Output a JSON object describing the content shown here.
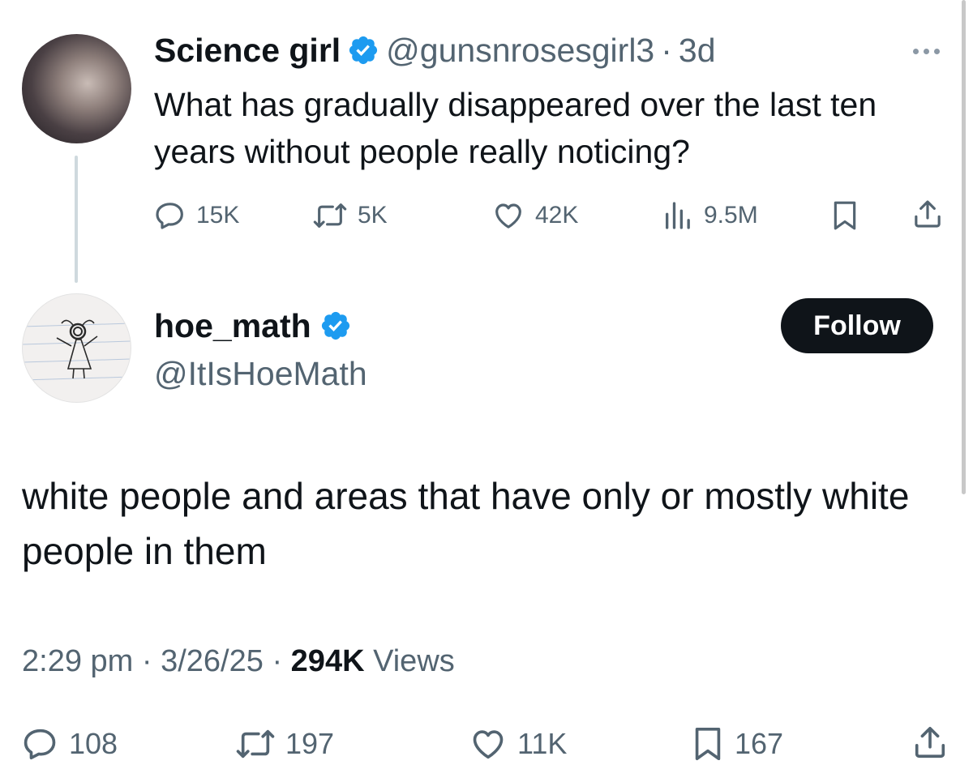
{
  "parent_tweet": {
    "display_name": "Science girl",
    "handle": "@gunsnrosesgirl3",
    "separator": "·",
    "age": "3d",
    "text": "What has gradually disappeared over the last ten years without people really noticing?",
    "stats": {
      "replies": "15K",
      "reposts": "5K",
      "likes": "42K",
      "views": "9.5M"
    }
  },
  "reply_tweet": {
    "display_name": "hoe_math",
    "handle": "@ItIsHoeMath",
    "follow_label": "Follow",
    "text": "white people and areas that have only or mostly white people in them",
    "time": "2:29 pm",
    "date": "3/26/25",
    "views_count": "294K",
    "views_label": "Views",
    "stats": {
      "replies": "108",
      "reposts": "197",
      "likes": "11K",
      "bookmarks": "167"
    }
  },
  "colors": {
    "text": "#0f1419",
    "secondary": "#536471",
    "verified": "#1d9bf0",
    "follow_bg": "#0f1419"
  }
}
